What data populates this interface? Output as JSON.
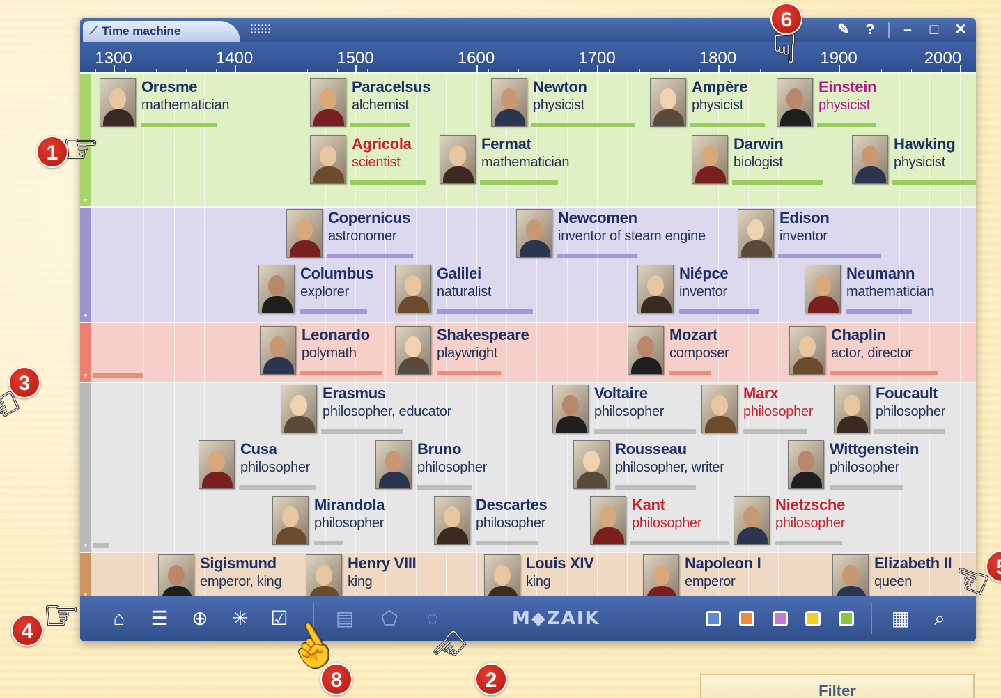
{
  "window": {
    "title": "Time machine"
  },
  "window_controls": {
    "pin": "✎",
    "help": "?",
    "minimize": "–",
    "maximize": "□",
    "close": "✕"
  },
  "timeline": {
    "ticks": [
      "1300",
      "1400",
      "1500",
      "1600",
      "1700",
      "1800",
      "1900",
      "2000"
    ]
  },
  "lanes": [
    {
      "id": "science",
      "color": "#dff0c4",
      "strip": "#a8d46a",
      "bar": "#9acb5e",
      "people": [
        {
          "name": "Oresme",
          "role": "mathematician",
          "style": "normal"
        },
        {
          "name": "Paracelsus",
          "role": "alchemist",
          "style": "normal"
        },
        {
          "name": "Newton",
          "role": "physicist",
          "style": "normal"
        },
        {
          "name": "Ampère",
          "role": "physicist",
          "style": "normal"
        },
        {
          "name": "Einstein",
          "role": "physicist",
          "style": "purple"
        },
        {
          "name": "Agricola",
          "role": "scientist",
          "style": "red"
        },
        {
          "name": "Fermat",
          "role": "mathematician",
          "style": "normal"
        },
        {
          "name": "Darwin",
          "role": "biologist",
          "style": "normal"
        },
        {
          "name": "Hawking",
          "role": "physicist",
          "style": "normal"
        }
      ]
    },
    {
      "id": "inventors",
      "color": "#dcd9ee",
      "strip": "#9c93cf",
      "bar": "#a39ad3",
      "people": [
        {
          "name": "Copernicus",
          "role": "astronomer",
          "style": "normal"
        },
        {
          "name": "Newcomen",
          "role": "inventor of steam engine",
          "style": "normal"
        },
        {
          "name": "Edison",
          "role": "inventor",
          "style": "normal"
        },
        {
          "name": "Columbus",
          "role": "explorer",
          "style": "normal"
        },
        {
          "name": "Galilei",
          "role": "naturalist",
          "style": "normal"
        },
        {
          "name": "Niépce",
          "role": "inventor",
          "style": "normal"
        },
        {
          "name": "Neumann",
          "role": "mathematician",
          "style": "normal"
        }
      ]
    },
    {
      "id": "arts",
      "color": "#f6d0c8",
      "strip": "#ec8070",
      "bar": "#ee8c7c",
      "people": [
        {
          "name": "Leonardo",
          "role": "polymath",
          "style": "normal"
        },
        {
          "name": "Shakespeare",
          "role": "playwright",
          "style": "normal"
        },
        {
          "name": "Mozart",
          "role": "composer",
          "style": "normal"
        },
        {
          "name": "Chaplin",
          "role": "actor, director",
          "style": "normal"
        }
      ]
    },
    {
      "id": "philosophy",
      "color": "#e6e6e6",
      "strip": "#b9b9b9",
      "bar": "#bdbdbd",
      "people": [
        {
          "name": "Erasmus",
          "role": "philosopher, educator",
          "style": "normal"
        },
        {
          "name": "Voltaire",
          "role": "philosopher",
          "style": "normal"
        },
        {
          "name": "Marx",
          "role": "philosopher",
          "style": "red"
        },
        {
          "name": "Foucault",
          "role": "philosopher",
          "style": "normal"
        },
        {
          "name": "Cusa",
          "role": "philosopher",
          "style": "normal"
        },
        {
          "name": "Bruno",
          "role": "philosopher",
          "style": "normal"
        },
        {
          "name": "Rousseau",
          "role": "philosopher, writer",
          "style": "normal"
        },
        {
          "name": "Wittgenstein",
          "role": "philosopher",
          "style": "normal"
        },
        {
          "name": "Mirandola",
          "role": "philosopher",
          "style": "normal"
        },
        {
          "name": "Descartes",
          "role": "philosopher",
          "style": "normal"
        },
        {
          "name": "Kant",
          "role": "philosopher",
          "style": "red"
        },
        {
          "name": "Nietzsche",
          "role": "philosopher",
          "style": "red"
        }
      ]
    },
    {
      "id": "rulers",
      "color": "#f0d9c2",
      "strip": "#cf9560",
      "bar": "#d49a66",
      "people": [
        {
          "name": "Sigismund",
          "role": "emperor, king",
          "style": "normal"
        },
        {
          "name": "Henry VIII",
          "role": "king",
          "style": "normal"
        },
        {
          "name": "Louis XIV",
          "role": "king",
          "style": "normal"
        },
        {
          "name": "Napoleon I",
          "role": "emperor",
          "style": "normal"
        },
        {
          "name": "Elizabeth II",
          "role": "queen",
          "style": "normal"
        }
      ]
    }
  ],
  "toolbar": {
    "logo": "M◆ZAIK",
    "left_icons": [
      "home-icon",
      "align-icon",
      "target-icon",
      "sparkle-icon",
      "checkbox-icon"
    ],
    "mid_icons": [
      "card-icon",
      "pentagon-icon",
      "lasso-icon"
    ],
    "color_filters": [
      "#5b8ad6",
      "#f08a3c",
      "#c07ad6",
      "#f2d21c",
      "#8cc63e"
    ],
    "right_icons": [
      "grid-icon",
      "search-icon"
    ]
  },
  "callouts": [
    "1",
    "2",
    "3",
    "4",
    "5",
    "6",
    "8"
  ],
  "filter": {
    "label": "Filter"
  }
}
